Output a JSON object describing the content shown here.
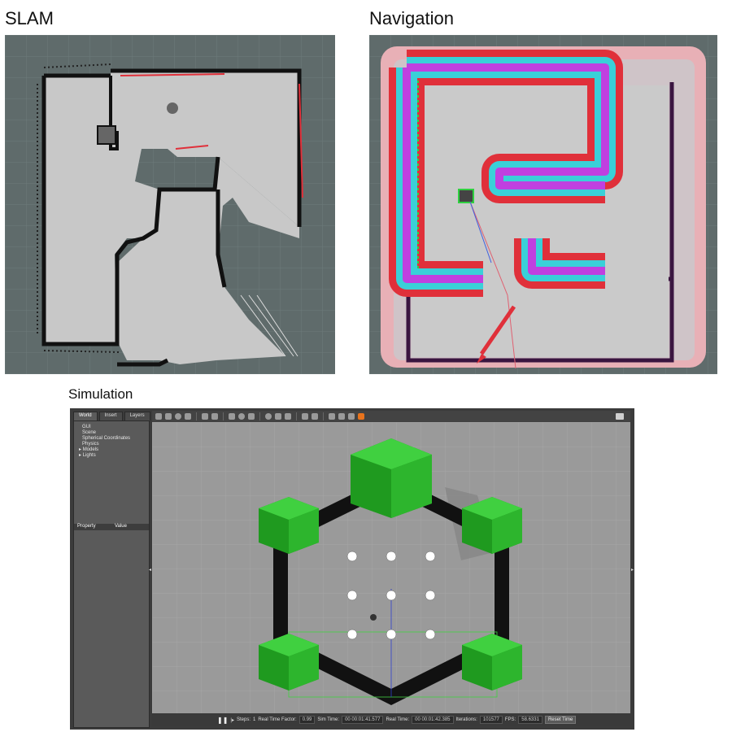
{
  "captions": {
    "slam": "SLAM",
    "navigation": "Navigation",
    "simulation": "Simulation"
  },
  "colors": {
    "grid_bg": "#5f6b6b",
    "free_space": "#c8c8c8",
    "obstacle": "#111111",
    "inflation_red": "#e0303a",
    "costmap_cyan": "#3ad0d8",
    "costmap_magenta": "#c040e0",
    "cube_green": "#2fb52f",
    "wall_black": "#111111",
    "ground": "#9a9a9a"
  },
  "simulation": {
    "tabs": [
      "World",
      "Insert",
      "Layers"
    ],
    "tree": {
      "items": [
        "GUI",
        "Scene",
        "Spherical Coordinates",
        "Physics"
      ],
      "expandable": [
        "Models",
        "Lights"
      ]
    },
    "property_header": {
      "property": "Property",
      "value": "Value"
    },
    "toolbar_icons": [
      "select-arrow-icon",
      "translate-icon",
      "rotate-icon",
      "scale-icon",
      "undo-icon",
      "redo-icon",
      "box-icon",
      "sphere-icon",
      "cylinder-icon",
      "point-light-icon",
      "spot-light-icon",
      "directional-light-icon",
      "copy-icon",
      "paste-icon",
      "align-icon",
      "snap-icon",
      "change-view-icon",
      "screenshot-icon"
    ],
    "status": {
      "steps_label": "Steps:",
      "steps_value": "1",
      "rtf_label": "Real Time Factor:",
      "rtf_value": "0.99",
      "sim_time_label": "Sim Time:",
      "sim_time_value": "00 00:01:41.577",
      "real_time_label": "Real Time:",
      "real_time_value": "00 00:01:42.385",
      "iterations_label": "Iterations:",
      "iterations_value": "101577",
      "fps_label": "FPS:",
      "fps_value": "58.6331",
      "reset_label": "Reset Time"
    }
  }
}
